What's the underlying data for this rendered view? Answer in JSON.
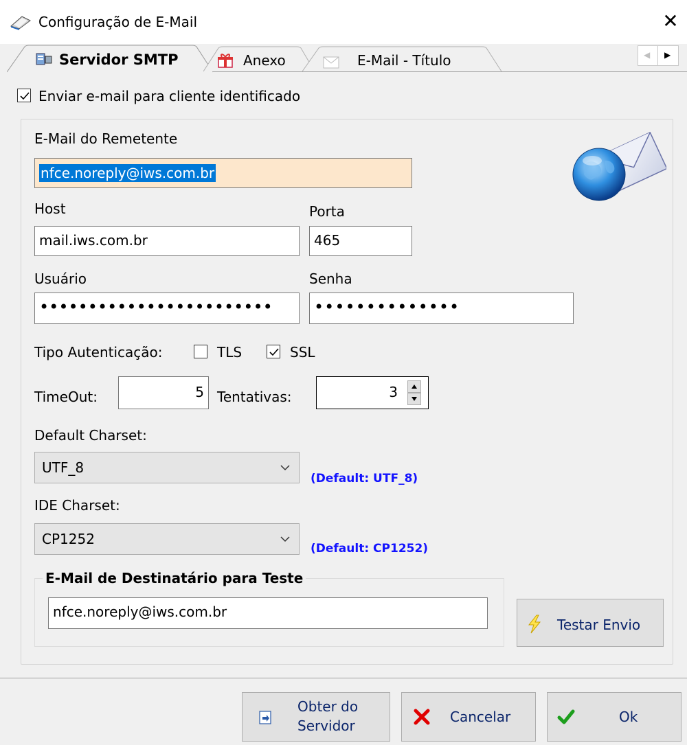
{
  "window": {
    "title": "Configuração de E-Mail",
    "close_label": "✕"
  },
  "tabs": [
    {
      "label": "Servidor SMTP",
      "icon": "server-icon",
      "active": true
    },
    {
      "label": "Anexo",
      "icon": "gift-icon",
      "active": false
    },
    {
      "label": "E-Mail - Título",
      "icon": "envelope-icon",
      "active": false
    }
  ],
  "tab_scroll": {
    "left": "◀",
    "right": "▶"
  },
  "send_to_client": {
    "label": "Enviar e-mail para cliente identificado",
    "checked": true
  },
  "sender_email": {
    "label": "E-Mail do Remetente",
    "value": "nfce.noreply@iws.com.br"
  },
  "host": {
    "label": "Host",
    "value": "mail.iws.com.br"
  },
  "port": {
    "label": "Porta",
    "value": "465"
  },
  "user": {
    "label": "Usuário",
    "value": "••••••••••••••••••••••••"
  },
  "password": {
    "label": "Senha",
    "value": "••••••••••••••"
  },
  "auth": {
    "label": "Tipo Autenticação:",
    "tls": {
      "label": "TLS",
      "checked": false
    },
    "ssl": {
      "label": "SSL",
      "checked": true
    }
  },
  "timeout": {
    "label": "TimeOut:",
    "value": "5"
  },
  "retries": {
    "label": "Tentativas:",
    "value": "3"
  },
  "default_charset": {
    "label": "Default Charset:",
    "value": "UTF_8",
    "hint": "(Default: UTF_8)"
  },
  "ide_charset": {
    "label": "IDE Charset:",
    "value": "CP1252",
    "hint": "(Default: CP1252)"
  },
  "test_recipient": {
    "label": "E-Mail de Destinatário para Teste",
    "value": "nfce.noreply@iws.com.br"
  },
  "buttons": {
    "test_send": "Testar Envio",
    "get_from_server_line1": "Obter do",
    "get_from_server_line2": "Servidor",
    "cancel": "Cancelar",
    "ok": "Ok"
  },
  "colors": {
    "hint": "#1212ff",
    "selection": "#0078d7",
    "focused_input_bg": "#fde7cc",
    "ok_check": "#1d9e1d",
    "cancel_x": "#e00000"
  }
}
